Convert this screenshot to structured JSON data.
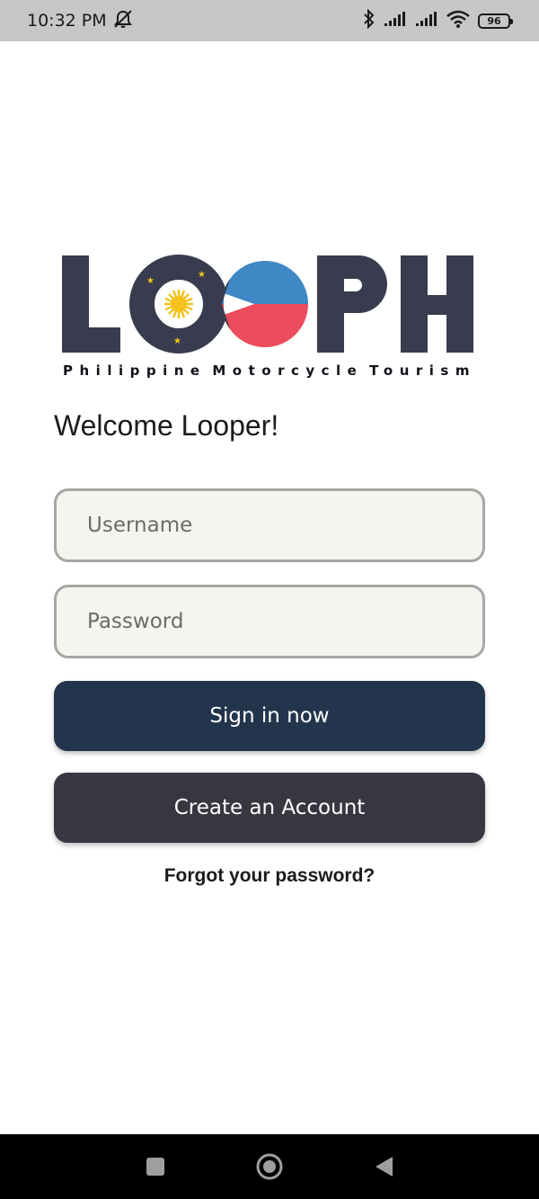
{
  "status_bar": {
    "time": "10:32 PM",
    "battery_level": "96",
    "icons": [
      "mute-notifications-icon",
      "bluetooth-icon",
      "cellular-signal-icon",
      "cellular-signal-icon",
      "wifi-icon",
      "battery-icon"
    ]
  },
  "logo": {
    "wordmark": "LOOPH",
    "tagline_words": [
      "Philippine",
      "Motorcycle",
      "Tourism"
    ],
    "colors": {
      "navy": "#383c4e",
      "blue": "#3f88c5",
      "red": "#ec4c5c",
      "sun": "#f5c21b"
    }
  },
  "welcome_text": "Welcome Looper!",
  "username_field": {
    "placeholder": "Username",
    "value": ""
  },
  "password_field": {
    "placeholder": "Password",
    "value": ""
  },
  "sign_in_button": {
    "label": "Sign in now",
    "color": "#22354d"
  },
  "create_account_button": {
    "label": "Create an Account",
    "color": "#383640"
  },
  "forgot_password_link": "Forgot your password?",
  "nav_bar": {
    "icons": [
      "recent-apps-icon",
      "home-icon",
      "back-icon"
    ]
  }
}
